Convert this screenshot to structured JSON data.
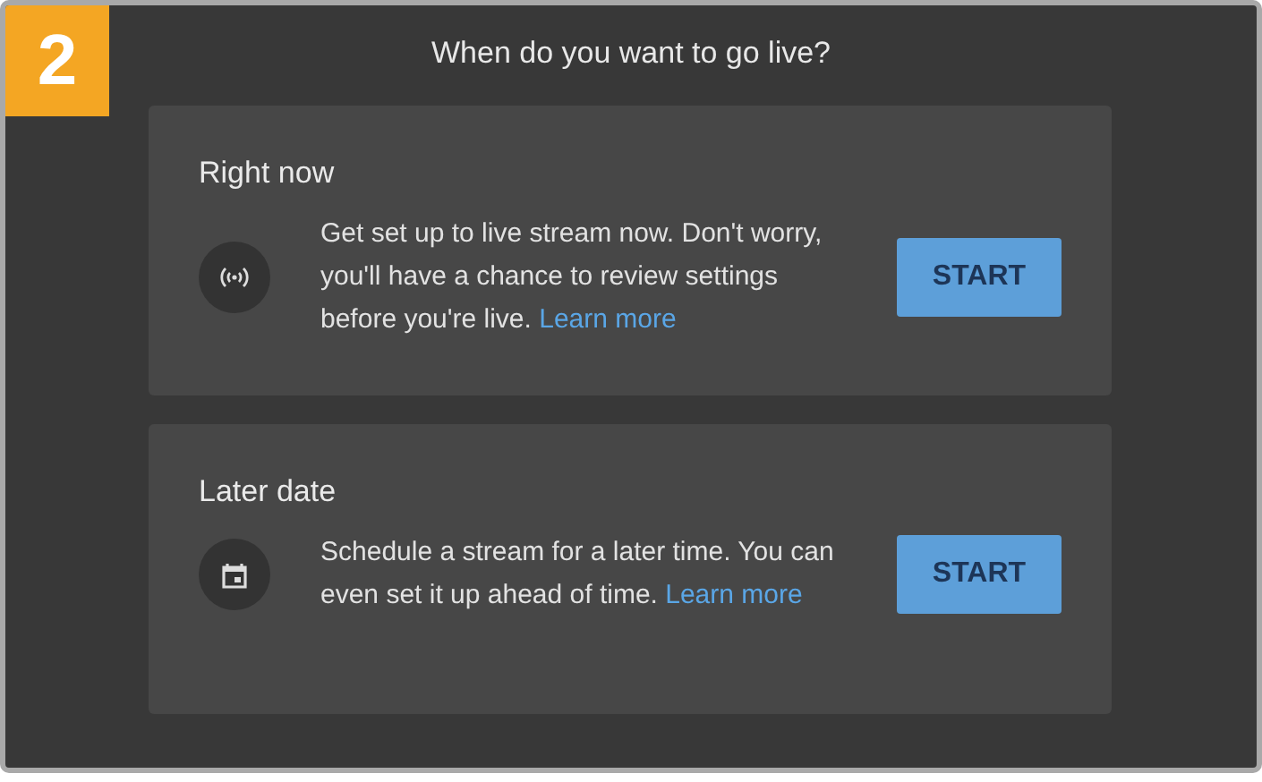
{
  "step_badge": "2",
  "title": "When do you want to go live?",
  "options": [
    {
      "heading": "Right now",
      "description": "Get set up to live stream now. Don't worry, you'll have a chance to review settings before you're live.",
      "link": "Learn more",
      "button": "START"
    },
    {
      "heading": "Later date",
      "description": "Schedule a stream for a later time. You can even set it up ahead of time.",
      "link": "Learn more",
      "button": "START"
    }
  ]
}
